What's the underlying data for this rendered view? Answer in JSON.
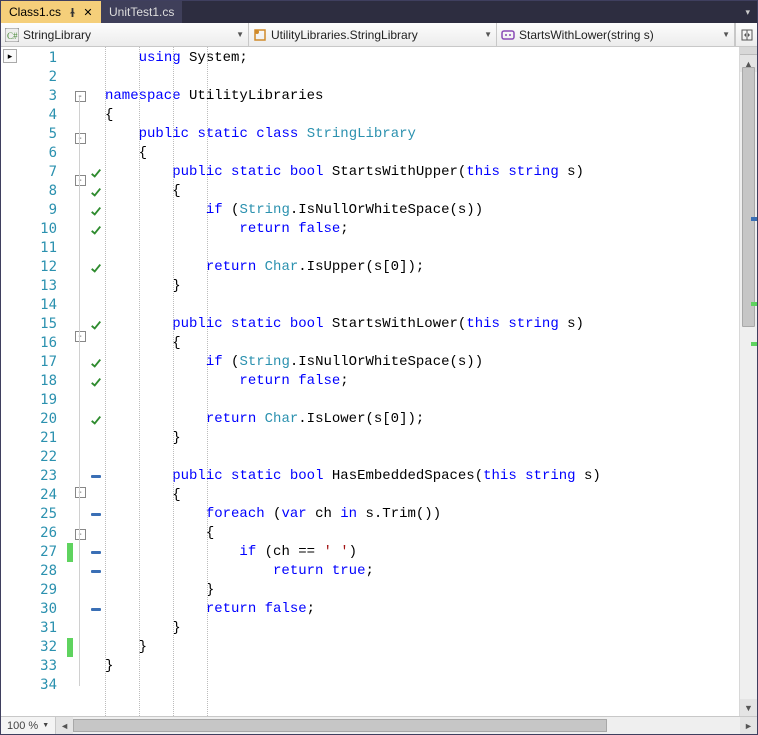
{
  "tabs": [
    {
      "label": "Class1.cs",
      "active": true,
      "pinned": true
    },
    {
      "label": "UnitTest1.cs",
      "active": false,
      "pinned": false
    }
  ],
  "nav": {
    "project": "StringLibrary",
    "class": "UtilityLibraries.StringLibrary",
    "member": "StartsWithLower(string s)"
  },
  "zoom": "100 %",
  "cursor_line": 16,
  "lines": [
    {
      "n": 1,
      "mk": "",
      "chg": "",
      "out": "",
      "tokens": [
        [
          "pln",
          "    "
        ],
        [
          "kw",
          "using"
        ],
        [
          "pln",
          " System;"
        ]
      ]
    },
    {
      "n": 2,
      "mk": "",
      "chg": "",
      "out": "",
      "tokens": []
    },
    {
      "n": 3,
      "mk": "",
      "chg": "",
      "out": "box",
      "tokens": [
        [
          "kw",
          "namespace"
        ],
        [
          "pln",
          " UtilityLibraries"
        ]
      ]
    },
    {
      "n": 4,
      "mk": "",
      "chg": "",
      "out": "",
      "tokens": [
        [
          "pln",
          "{"
        ]
      ]
    },
    {
      "n": 5,
      "mk": "",
      "chg": "",
      "out": "box",
      "tokens": [
        [
          "pln",
          "    "
        ],
        [
          "kw",
          "public"
        ],
        [
          "pln",
          " "
        ],
        [
          "kw",
          "static"
        ],
        [
          "pln",
          " "
        ],
        [
          "kw",
          "class"
        ],
        [
          "pln",
          " "
        ],
        [
          "typ",
          "StringLibrary"
        ]
      ]
    },
    {
      "n": 6,
      "mk": "",
      "chg": "",
      "out": "",
      "tokens": [
        [
          "pln",
          "    {"
        ]
      ]
    },
    {
      "n": 7,
      "mk": "check",
      "chg": "",
      "out": "box",
      "tokens": [
        [
          "pln",
          "        "
        ],
        [
          "kw",
          "public"
        ],
        [
          "pln",
          " "
        ],
        [
          "kw",
          "static"
        ],
        [
          "pln",
          " "
        ],
        [
          "kw",
          "bool"
        ],
        [
          "pln",
          " StartsWithUpper("
        ],
        [
          "kw",
          "this"
        ],
        [
          "pln",
          " "
        ],
        [
          "kw",
          "string"
        ],
        [
          "pln",
          " s)"
        ]
      ]
    },
    {
      "n": 8,
      "mk": "check",
      "chg": "",
      "out": "",
      "tokens": [
        [
          "pln",
          "        {"
        ]
      ]
    },
    {
      "n": 9,
      "mk": "check",
      "chg": "",
      "out": "",
      "tokens": [
        [
          "pln",
          "            "
        ],
        [
          "kw",
          "if"
        ],
        [
          "pln",
          " ("
        ],
        [
          "typ",
          "String"
        ],
        [
          "pln",
          ".IsNullOrWhiteSpace(s))"
        ]
      ]
    },
    {
      "n": 10,
      "mk": "check",
      "chg": "",
      "out": "",
      "tokens": [
        [
          "pln",
          "                "
        ],
        [
          "kw",
          "return"
        ],
        [
          "pln",
          " "
        ],
        [
          "kw",
          "false"
        ],
        [
          "pln",
          ";"
        ]
      ]
    },
    {
      "n": 11,
      "mk": "",
      "chg": "",
      "out": "",
      "tokens": []
    },
    {
      "n": 12,
      "mk": "check",
      "chg": "",
      "out": "",
      "tokens": [
        [
          "pln",
          "            "
        ],
        [
          "kw",
          "return"
        ],
        [
          "pln",
          " "
        ],
        [
          "typ",
          "Char"
        ],
        [
          "pln",
          ".IsUpper(s[0]);"
        ]
      ]
    },
    {
      "n": 13,
      "mk": "",
      "chg": "",
      "out": "",
      "tokens": [
        [
          "pln",
          "        }"
        ]
      ]
    },
    {
      "n": 14,
      "mk": "",
      "chg": "",
      "out": "",
      "tokens": []
    },
    {
      "n": 15,
      "mk": "check",
      "chg": "",
      "out": "box",
      "tokens": [
        [
          "pln",
          "        "
        ],
        [
          "kw",
          "public"
        ],
        [
          "pln",
          " "
        ],
        [
          "kw",
          "static"
        ],
        [
          "pln",
          " "
        ],
        [
          "kw",
          "bool"
        ],
        [
          "pln",
          " StartsWithLower("
        ],
        [
          "kw",
          "this"
        ],
        [
          "pln",
          " "
        ],
        [
          "kw",
          "string"
        ],
        [
          "pln",
          " s)"
        ]
      ]
    },
    {
      "n": 16,
      "mk": "",
      "chg": "",
      "out": "",
      "tokens": [
        [
          "pln",
          "        {"
        ]
      ]
    },
    {
      "n": 17,
      "mk": "check",
      "chg": "",
      "out": "",
      "tokens": [
        [
          "pln",
          "            "
        ],
        [
          "kw",
          "if"
        ],
        [
          "pln",
          " ("
        ],
        [
          "typ",
          "String"
        ],
        [
          "pln",
          ".IsNullOrWhiteSpace(s))"
        ]
      ]
    },
    {
      "n": 18,
      "mk": "check",
      "chg": "",
      "out": "",
      "tokens": [
        [
          "pln",
          "                "
        ],
        [
          "kw",
          "return"
        ],
        [
          "pln",
          " "
        ],
        [
          "kw",
          "false"
        ],
        [
          "pln",
          ";"
        ]
      ]
    },
    {
      "n": 19,
      "mk": "",
      "chg": "",
      "out": "",
      "tokens": []
    },
    {
      "n": 20,
      "mk": "check",
      "chg": "",
      "out": "",
      "tokens": [
        [
          "pln",
          "            "
        ],
        [
          "kw",
          "return"
        ],
        [
          "pln",
          " "
        ],
        [
          "typ",
          "Char"
        ],
        [
          "pln",
          ".IsLower(s[0]);"
        ]
      ]
    },
    {
      "n": 21,
      "mk": "",
      "chg": "",
      "out": "",
      "tokens": [
        [
          "pln",
          "        }"
        ]
      ]
    },
    {
      "n": 22,
      "mk": "",
      "chg": "",
      "out": "",
      "tokens": []
    },
    {
      "n": 23,
      "mk": "dash",
      "chg": "",
      "out": "box",
      "tokens": [
        [
          "pln",
          "        "
        ],
        [
          "kw",
          "public"
        ],
        [
          "pln",
          " "
        ],
        [
          "kw",
          "static"
        ],
        [
          "pln",
          " "
        ],
        [
          "kw",
          "bool"
        ],
        [
          "pln",
          " HasEmbeddedSpaces("
        ],
        [
          "kw",
          "this"
        ],
        [
          "pln",
          " "
        ],
        [
          "kw",
          "string"
        ],
        [
          "pln",
          " s)"
        ]
      ]
    },
    {
      "n": 24,
      "mk": "",
      "chg": "",
      "out": "",
      "tokens": [
        [
          "pln",
          "        {"
        ]
      ]
    },
    {
      "n": 25,
      "mk": "dash",
      "chg": "",
      "out": "box",
      "tokens": [
        [
          "pln",
          "            "
        ],
        [
          "kw",
          "foreach"
        ],
        [
          "pln",
          " ("
        ],
        [
          "kw",
          "var"
        ],
        [
          "pln",
          " ch "
        ],
        [
          "kw",
          "in"
        ],
        [
          "pln",
          " s.Trim())"
        ]
      ]
    },
    {
      "n": 26,
      "mk": "",
      "chg": "",
      "out": "",
      "tokens": [
        [
          "pln",
          "            {"
        ]
      ]
    },
    {
      "n": 27,
      "mk": "dash",
      "chg": "green",
      "out": "",
      "tokens": [
        [
          "pln",
          "                "
        ],
        [
          "kw",
          "if"
        ],
        [
          "pln",
          " (ch == "
        ],
        [
          "str",
          "' '"
        ],
        [
          "pln",
          ")"
        ]
      ]
    },
    {
      "n": 28,
      "mk": "dash",
      "chg": "",
      "out": "",
      "tokens": [
        [
          "pln",
          "                    "
        ],
        [
          "kw",
          "return"
        ],
        [
          "pln",
          " "
        ],
        [
          "kw",
          "true"
        ],
        [
          "pln",
          ";"
        ]
      ]
    },
    {
      "n": 29,
      "mk": "",
      "chg": "",
      "out": "",
      "tokens": [
        [
          "pln",
          "            }"
        ]
      ]
    },
    {
      "n": 30,
      "mk": "dash",
      "chg": "",
      "out": "",
      "tokens": [
        [
          "pln",
          "            "
        ],
        [
          "kw",
          "return"
        ],
        [
          "pln",
          " "
        ],
        [
          "kw",
          "false"
        ],
        [
          "pln",
          ";"
        ]
      ]
    },
    {
      "n": 31,
      "mk": "",
      "chg": "",
      "out": "",
      "tokens": [
        [
          "pln",
          "        }"
        ]
      ]
    },
    {
      "n": 32,
      "mk": "",
      "chg": "green",
      "out": "",
      "tokens": [
        [
          "pln",
          "    }"
        ]
      ]
    },
    {
      "n": 33,
      "mk": "",
      "chg": "",
      "out": "",
      "tokens": [
        [
          "pln",
          "}"
        ]
      ]
    },
    {
      "n": 34,
      "mk": "",
      "chg": "",
      "out": "",
      "tokens": []
    }
  ]
}
